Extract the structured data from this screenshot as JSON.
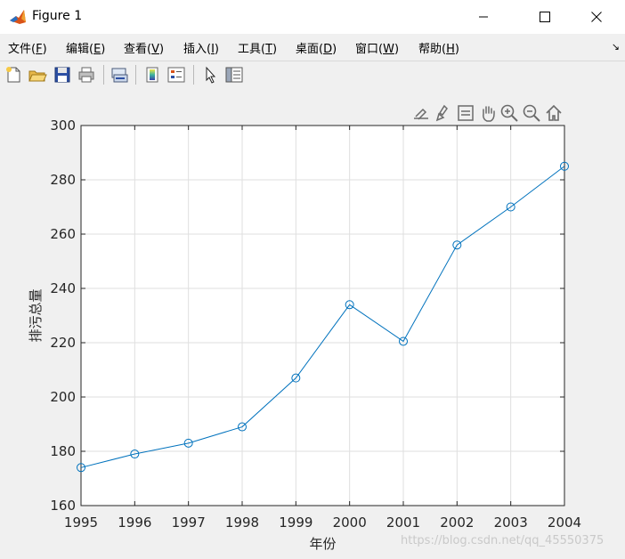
{
  "window": {
    "title": "Figure 1",
    "controls": {
      "minimize": "minimize-icon",
      "maximize": "maximize-icon",
      "close": "close-icon"
    }
  },
  "menubar": {
    "items": [
      {
        "label": "文件(",
        "mnemonic": "F",
        "suffix": ")"
      },
      {
        "label": "编辑(",
        "mnemonic": "E",
        "suffix": ")"
      },
      {
        "label": "查看(",
        "mnemonic": "V",
        "suffix": ")"
      },
      {
        "label": "插入(",
        "mnemonic": "I",
        "suffix": ")"
      },
      {
        "label": "工具(",
        "mnemonic": "T",
        "suffix": ")"
      },
      {
        "label": "桌面(",
        "mnemonic": "D",
        "suffix": ")"
      },
      {
        "label": "窗口(",
        "mnemonic": "W",
        "suffix": ")"
      },
      {
        "label": "帮助(",
        "mnemonic": "H",
        "suffix": ")"
      }
    ],
    "corner": "↘"
  },
  "toolbar": {
    "icons": [
      "new-figure-icon",
      "open-file-icon",
      "save-icon",
      "print-icon",
      "link-plot-icon",
      "colorbar-icon",
      "legend-icon",
      "edit-plot-pointer-icon",
      "property-inspector-icon"
    ]
  },
  "axes_toolbar": {
    "icons": [
      "export-icon",
      "brush-icon",
      "data-tips-icon",
      "pan-icon",
      "zoom-in-icon",
      "zoom-out-icon",
      "home-icon"
    ]
  },
  "chart_data": {
    "type": "line",
    "x": [
      1995,
      1996,
      1997,
      1998,
      1999,
      2000,
      2001,
      2002,
      2003,
      2004
    ],
    "series": [
      {
        "values": [
          174,
          179,
          183,
          189,
          207,
          234,
          220.5,
          256,
          270,
          285
        ],
        "color": "#0072bd",
        "marker": "circle"
      }
    ],
    "xlabel": "年份",
    "ylabel": "排污总量",
    "xlim": [
      1995,
      2004
    ],
    "ylim": [
      160,
      300
    ],
    "xticks": [
      "1995",
      "1996",
      "1997",
      "1998",
      "1999",
      "2000",
      "2001",
      "2002",
      "2003",
      "2004"
    ],
    "yticks": [
      "160",
      "180",
      "200",
      "220",
      "240",
      "260",
      "280",
      "300"
    ],
    "grid": true
  },
  "watermark": "https://blog.csdn.net/qq_45550375"
}
